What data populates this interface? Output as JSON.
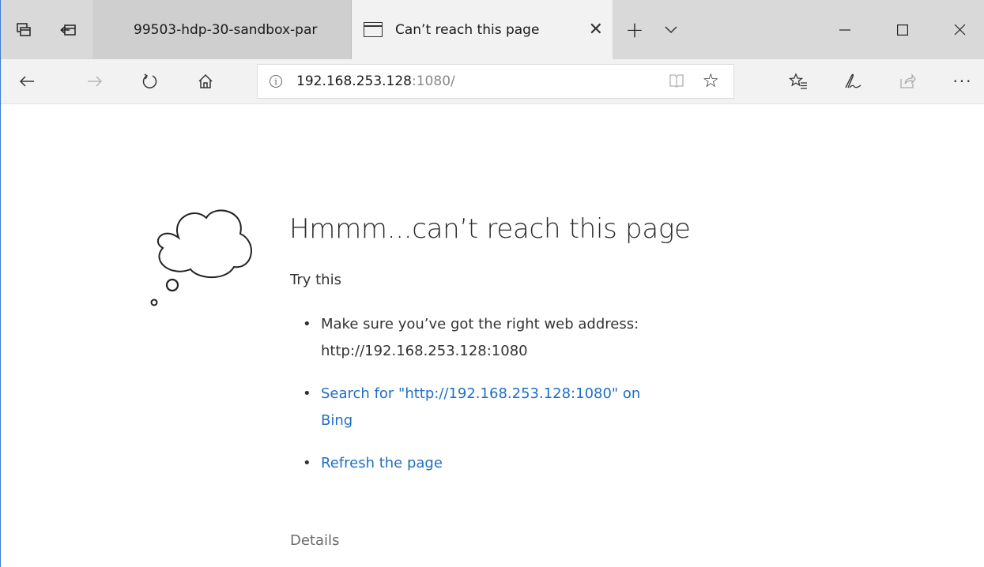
{
  "tabs": [
    {
      "title": "99503-hdp-30-sandbox-par",
      "active": false
    },
    {
      "title": "Can’t reach this page",
      "active": true
    }
  ],
  "address": {
    "host": "192.168.253.128",
    "port_path": ":1080/"
  },
  "page": {
    "heading": "Hmmm...can’t reach this page",
    "try_this": "Try this",
    "suggestion_1": "Make sure you’ve got the right web address: http://192.168.253.128:1080",
    "suggestion_2": "Search for \"http://192.168.253.128:1080\" on Bing",
    "suggestion_3": "Refresh the page",
    "details": "Details"
  },
  "colors": {
    "link": "#1f6fc5",
    "tabstrip": "#d9d9d9",
    "active_tab": "#f2f2f2"
  },
  "icons": [
    "tab-preview-icon",
    "set-tabs-aside-icon",
    "new-tab-icon",
    "tab-dropdown-icon",
    "minimize-icon",
    "maximize-icon",
    "window-close-icon",
    "back-icon",
    "forward-icon",
    "refresh-icon",
    "home-icon",
    "info-icon",
    "reading-view-icon",
    "favorite-star-icon",
    "favorites-hub-icon",
    "notes-pen-icon",
    "share-icon",
    "more-icon",
    "cloud-icon"
  ]
}
